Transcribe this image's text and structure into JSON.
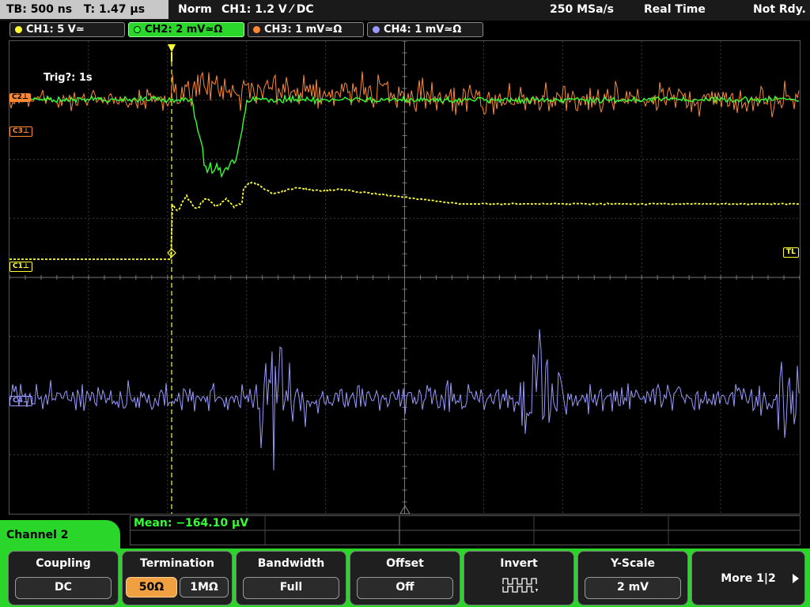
{
  "status_bar": {
    "timebase": "TB: 500 ns",
    "trigger_time": "T: 1.47 µs",
    "mode": "Norm",
    "trigger_source": "CH1: 1.2 V ⁄ DC",
    "sample_rate": "250 MSa/s",
    "acq_mode": "Real Time",
    "ready_state": "Not Rdy."
  },
  "channel_tabs": [
    {
      "label": "CH1: 5 V≃",
      "color": "#ffff33",
      "active": false
    },
    {
      "label": "CH2: 2 mV≃Ω",
      "color": "#33ff33",
      "active": true
    },
    {
      "label": "CH3: 1 mV≃Ω",
      "color": "#ff8833",
      "active": false
    },
    {
      "label": "CH4: 1 mV≃Ω",
      "color": "#9999ff",
      "active": false
    }
  ],
  "plot": {
    "trigger_status": "Trig?: 1s",
    "markers": {
      "ch3": "C3⊥",
      "ch1": "C1⊥",
      "ch2": "C2⊥",
      "ch4": "C4⊥",
      "trigger_level": "TL"
    },
    "colors": {
      "ch1": "#ffff33",
      "ch2": "#33ff33",
      "ch3": "#ff8833",
      "ch4": "#9999ff",
      "grid": "#3c3c3c",
      "trigger": "#ffff33"
    }
  },
  "measurement": {
    "mean": "Mean: −164.10 µV"
  },
  "menu": {
    "title": "Channel 2",
    "softkeys": {
      "coupling": {
        "title": "Coupling",
        "value": "DC"
      },
      "termination": {
        "title": "Termination",
        "option_a": "50Ω",
        "option_b": "1MΩ",
        "selected": "50Ω"
      },
      "bandwidth": {
        "title": "Bandwidth",
        "value": "Full"
      },
      "offset": {
        "title": "Offset",
        "value": "Off"
      },
      "invert": {
        "title": "Invert",
        "icon": "invert-waveform-icon"
      },
      "yscale": {
        "title": "Y-Scale",
        "value": "2 mV"
      },
      "more": {
        "label": "More 1|2"
      }
    }
  }
}
